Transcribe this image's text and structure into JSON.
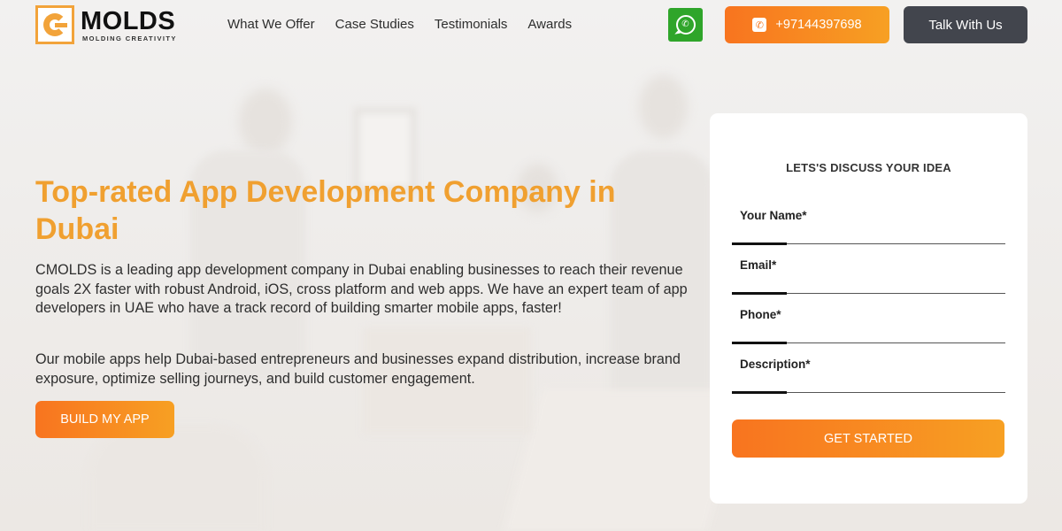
{
  "header": {
    "logo": {
      "name": "MOLDS",
      "tagline": "MOLDING CREATIVITY"
    },
    "nav": [
      "What We Offer",
      "Case Studies",
      "Testimonials",
      "Awards"
    ],
    "whatsapp_icon": "whatsapp-icon",
    "phone_label": "+97144397698",
    "phone_icon": "phone-icon",
    "talk_label": "Talk With Us"
  },
  "hero": {
    "title": "Top-rated App Development Company in Dubai",
    "paragraph1": "CMOLDS is a leading app development company in Dubai enabling businesses to reach their revenue goals 2X faster with robust Android, iOS, cross platform and web apps. We have an expert team of app developers in UAE who have a track record of building smarter mobile apps, faster!",
    "paragraph2": "Our mobile apps help Dubai-based entrepreneurs and businesses expand distribution, increase brand exposure, optimize selling journeys, and build customer engagement.",
    "cta_label": "BUILD MY APP"
  },
  "form": {
    "title": "LETS'S DISCUSS YOUR IDEA",
    "fields": [
      {
        "label": "Your Name*",
        "value": ""
      },
      {
        "label": "Email*",
        "value": ""
      },
      {
        "label": "Phone*",
        "value": ""
      },
      {
        "label": "Description*",
        "value": ""
      }
    ],
    "submit_label": "GET STARTED"
  },
  "colors": {
    "accent_orange": "#f0a030",
    "button_gradient_start": "#f8741f",
    "button_gradient_end": "#f7a023",
    "whatsapp_green": "#2fa52a",
    "dark_button": "#42454d"
  }
}
